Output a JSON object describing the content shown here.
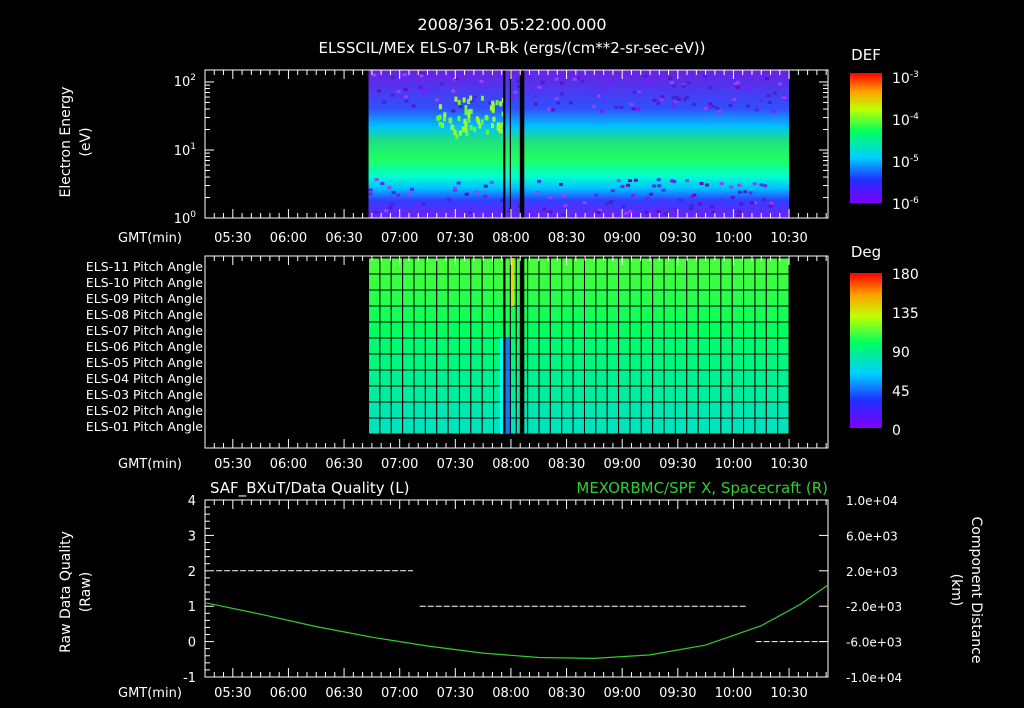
{
  "header": {
    "timestamp": "2008/361 05:22:00.000",
    "subtitle": "ELSSCIL/MEx ELS-07 LR-Bk  (ergs/(cm**2-sr-sec-eV))"
  },
  "time_ticks": [
    "05:30",
    "06:00",
    "06:30",
    "07:00",
    "07:30",
    "08:00",
    "08:30",
    "09:00",
    "09:30",
    "10:00",
    "10:30"
  ],
  "gmt_label": "GMT(min)",
  "colors": {
    "background": "#000000",
    "axis": "#ffffff",
    "grid": "#000000",
    "green_trace": "#33cc33"
  },
  "chart_data": [
    {
      "type": "heatmap",
      "name": "energy-spectrogram",
      "title": "ELSSCIL/MEx ELS-07 LR-Bk",
      "ylabel_line1": "Electron Energy",
      "ylabel_line2": "(eV)",
      "y_scale": "log",
      "ylim": [
        1,
        150
      ],
      "y_ticks": [
        {
          "base": "10",
          "exp": "0"
        },
        {
          "base": "10",
          "exp": "1"
        },
        {
          "base": "10",
          "exp": "2"
        }
      ],
      "xlim_hours": [
        5.25,
        10.85
      ],
      "data_span_hours": [
        6.72,
        10.5
      ],
      "colorbar": {
        "title": "DEF",
        "scale": "log",
        "ticks": [
          {
            "base": "10",
            "exp": "-3"
          },
          {
            "base": "10",
            "exp": "-4"
          },
          {
            "base": "10",
            "exp": "-5"
          },
          {
            "base": "10",
            "exp": "-6"
          }
        ]
      }
    },
    {
      "type": "heatmap",
      "name": "pitch-angle",
      "colorbar": {
        "title": "Deg",
        "ticks": [
          "180",
          "135",
          "90",
          "45",
          "0"
        ],
        "range": [
          0,
          180
        ]
      },
      "row_labels": [
        "ELS-11 Pitch Angle",
        "ELS-10 Pitch Angle",
        "ELS-09 Pitch Angle",
        "ELS-08 Pitch Angle",
        "ELS-07 Pitch Angle",
        "ELS-06 Pitch Angle",
        "ELS-05 Pitch Angle",
        "ELS-04 Pitch Angle",
        "ELS-03 Pitch Angle",
        "ELS-02 Pitch Angle",
        "ELS-01 Pitch Angle"
      ],
      "row_values_deg": [
        110,
        108,
        105,
        102,
        99,
        95,
        92,
        88,
        85,
        81,
        78
      ],
      "xlim_hours": [
        5.25,
        10.85
      ],
      "data_span_hours": [
        6.72,
        10.5
      ]
    },
    {
      "type": "line",
      "name": "data-quality-and-position",
      "left_title": "SAF_BXuT/Data Quality (L)",
      "right_title": "MEXORBMC/SPF X, Spacecraft (R)",
      "ylabel_left_line1": "Raw Data Quality",
      "ylabel_left_line2": "(Raw)",
      "ylabel_right_line1": "Component Distance",
      "ylabel_right_line2": "(km)",
      "ylim_left": [
        -1,
        4
      ],
      "y_ticks_left": [
        "4",
        "3",
        "2",
        "1",
        "0",
        "-1"
      ],
      "y_ticks_right": [
        "1.0e+04",
        "6.0e+03",
        "2.0e+03",
        "-2.0e+03",
        "-6.0e+03",
        "-1.0e+04"
      ],
      "ylim_right": [
        -10000,
        10000
      ],
      "xlim_hours": [
        5.25,
        10.85
      ],
      "quality_segments": [
        {
          "x_start": 5.35,
          "x_end": 7.12,
          "y": 2
        },
        {
          "x_start": 7.18,
          "x_end": 10.12,
          "y": 1
        },
        {
          "x_start": 10.2,
          "x_end": 10.82,
          "y": 0
        }
      ],
      "spacecraft_x_km": {
        "x_hours": [
          5.25,
          5.75,
          6.25,
          6.75,
          7.25,
          7.75,
          8.25,
          8.75,
          9.25,
          9.75,
          10.25,
          10.6,
          10.85
        ],
        "values": [
          -1600,
          -2900,
          -4300,
          -5500,
          -6500,
          -7300,
          -7800,
          -7900,
          -7500,
          -6400,
          -4200,
          -1800,
          400
        ]
      }
    }
  ]
}
